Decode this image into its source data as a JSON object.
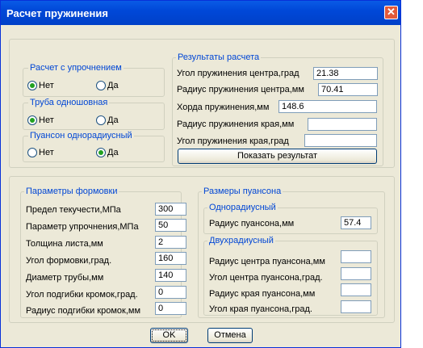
{
  "window": {
    "title": "Расчет пружинения"
  },
  "hardening": {
    "title": "Расчет с упрочнением",
    "no": "Нет",
    "yes": "Да",
    "selected": "Нет"
  },
  "pipe": {
    "title": "Труба одношовная",
    "no": "Нет",
    "yes": "Да",
    "selected": "Нет"
  },
  "punch_type": {
    "title": "Пуансон однорадиусный",
    "no": "Нет",
    "yes": "Да",
    "selected": "Да"
  },
  "results": {
    "title": "Результаты расчета",
    "rows": [
      {
        "label": "Угол пружинения центра,град",
        "value": "21.38"
      },
      {
        "label": "Радиус пружинения центра,мм",
        "value": "70.41"
      },
      {
        "label": "Хорда пружинения,мм",
        "value": "148.6"
      },
      {
        "label": "Радиус пружинения края,мм",
        "value": ""
      },
      {
        "label": "Угол пружинения края,град",
        "value": ""
      }
    ],
    "show_button": "Показать результат"
  },
  "forming": {
    "title": "Параметры формовки",
    "rows": [
      {
        "label": "Предел текучести,МПа",
        "value": "300"
      },
      {
        "label": "Параметр упрочнения,МПа",
        "value": "50"
      },
      {
        "label": "Толщина листа,мм",
        "value": "2"
      },
      {
        "label": "Угол формовки,град.",
        "value": "160"
      },
      {
        "label": "Диаметр трубы,мм",
        "value": "140"
      },
      {
        "label": "Угол подгибки кромок,град.",
        "value": "0"
      },
      {
        "label": "Радиус подгибки кромок,мм",
        "value": "0"
      }
    ]
  },
  "punch": {
    "title": "Размеры пуансона",
    "single": {
      "title": "Однорадиусный",
      "label": "Радиус пуансона,мм",
      "value": "57.4"
    },
    "double": {
      "title": "Двухрадиусный",
      "rows": [
        {
          "label": "Радиус центра пуансона,мм",
          "value": ""
        },
        {
          "label": "Угол центра пуансона,град.",
          "value": ""
        },
        {
          "label": "Радиус края пуансона,мм",
          "value": ""
        },
        {
          "label": "Угол края пуансона,град.",
          "value": ""
        }
      ]
    }
  },
  "buttons": {
    "ok": "OK",
    "cancel": "Отмена"
  }
}
